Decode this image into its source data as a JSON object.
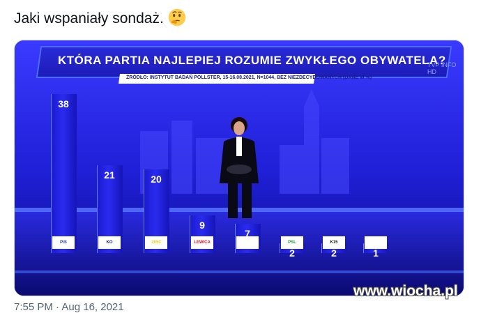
{
  "tweet": {
    "text": "Jaki wspaniały sondaż.",
    "emoji": "thinking-face-icon",
    "timestamp": "7:55 PM · Aug 16, 2021"
  },
  "tv": {
    "headline": "KTÓRA PARTIA NAJLEPIEJ ROZUMIE ZWYKŁEGO OBYWATELA?",
    "source": "ŹRÓDŁO: INSTYTUT BADAŃ POLLSTER, 15-16.08.2021, N=1044, BEZ NIEZDECYDOWANYCH (DANE W %)",
    "channel": "TVP INFO HD"
  },
  "chart_data": {
    "type": "bar",
    "title": "KTÓRA PARTIA NAJLEPIEJ ROZUMIE ZWYKŁEGO OBYWATELA?",
    "categories": [
      "PiS",
      "KO",
      "2050",
      "LEWICA",
      "PSL-Kukiz",
      "PSL",
      "K15",
      "Porozumienie"
    ],
    "values": [
      38,
      21,
      20,
      9,
      7,
      2,
      2,
      1
    ],
    "logo_labels": [
      "PiS",
      "KO",
      "2050",
      "LEWICA",
      "",
      "PSL",
      "K15",
      ""
    ],
    "logo_colors": [
      "#1e3a9a",
      "#1a2a8a",
      "#f2d21c",
      "#d81a2a",
      "#ffffff",
      "#1f9a3a",
      "#1a1a1a",
      "#1a3a8a"
    ],
    "ylabel": "",
    "ylim": [
      0,
      40
    ],
    "grid": false
  },
  "watermark": "www.wiocha.pl"
}
